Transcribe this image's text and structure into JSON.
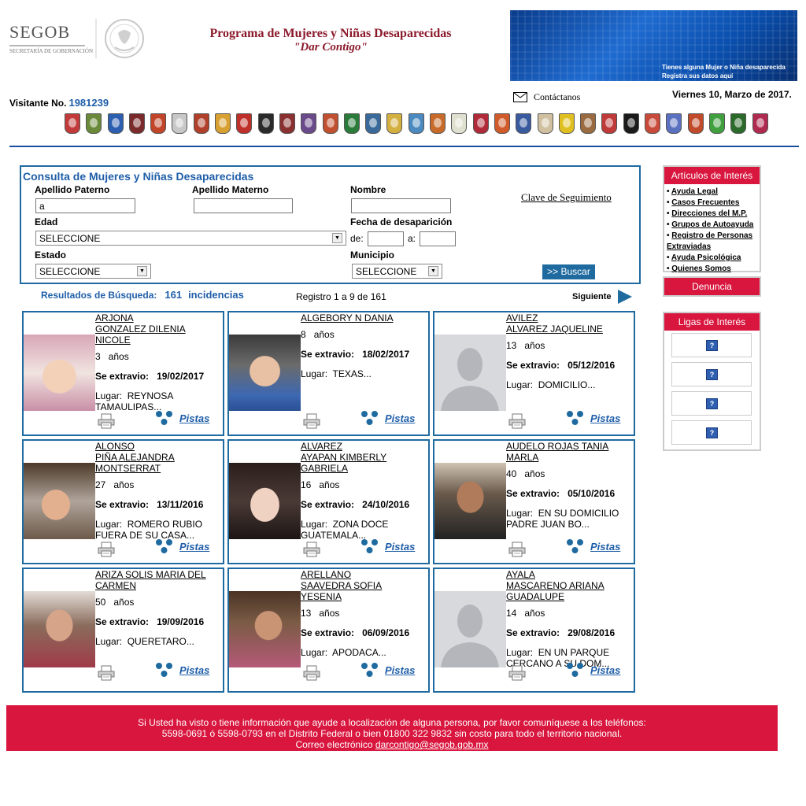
{
  "header": {
    "logo_text": "SEGOB",
    "logo_subtext": "SECRETARÍA DE GOBERNACIÓN",
    "program_title": "Programa de Mujeres y Niñas Desaparecidas",
    "program_subtitle": "\"Dar Contigo\"",
    "banner_line1": "Tienes alguna Mujer o Niña desaparecida",
    "banner_line2": "Registra sus datos aquí",
    "visitor_label": "Visitante No.",
    "visitor_number": "1981239",
    "contact_label": "Contáctanos",
    "date": "Viernes 10, Marzo de 2017."
  },
  "state_shields": [
    "#c23a3a",
    "#6a8a3a",
    "#2d5fb0",
    "#7a2a2a",
    "#c2452a",
    "#c8c8c8",
    "#b0402a",
    "#d8a030",
    "#c0302a",
    "#2a2a2a",
    "#8a3030",
    "#6a4a8a",
    "#c05030",
    "#2a7a3a",
    "#3a6a9a",
    "#d4b040",
    "#4a8ac0",
    "#c86a2a",
    "#e0e0d0",
    "#b02a3a",
    "#d05a2a",
    "#3a5aa0",
    "#d0c0a0",
    "#e0c020",
    "#9a6a40",
    "#c03a3a",
    "#1a1a1a",
    "#c84a3a",
    "#5a70c0",
    "#c04a2a",
    "#40a040",
    "#2a6a2a",
    "#b02a50"
  ],
  "search": {
    "title": "Consulta de Mujeres y Niñas Desaparecidas",
    "apellido_paterno_label": "Apellido Paterno",
    "apellido_paterno_value": "a",
    "apellido_materno_label": "Apellido Materno",
    "apellido_materno_value": "",
    "nombre_label": "Nombre",
    "nombre_value": "",
    "clave_link": "Clave de Seguimiento",
    "edad_label": "Edad",
    "edad_value": "SELECCIONE",
    "fecha_label": "Fecha de desaparición",
    "de_label": "de:",
    "a_label": "a:",
    "estado_label": "Estado",
    "estado_value": "SELECCIONE",
    "municipio_label": "Municipio",
    "municipio_value": "SELECCIONE",
    "buscar_label": ">> Buscar"
  },
  "results": {
    "label": "Resultados de Búsqueda:",
    "count": "161",
    "incidencias": "incidencias",
    "registro": "Registro 1 a 9 de 161",
    "siguiente": "Siguiente"
  },
  "card_labels": {
    "anos": "años",
    "se_extravio": "Se extravio:",
    "lugar": "Lugar:",
    "pistas": "Pistas"
  },
  "cards": [
    {
      "name": [
        "ARJONA",
        " GONZALEZ DILENIA",
        "NICOLE"
      ],
      "age": "3",
      "date": "19/02/2017",
      "lugar": [
        "REYNOSA",
        "TAMAULIPAS..."
      ],
      "photo": "child-girl"
    },
    {
      "name": [
        "ALGEBORY  N DANIA"
      ],
      "age": "8",
      "date": "18/02/2017",
      "lugar": [
        "TEXAS..."
      ],
      "photo": "child-girl"
    },
    {
      "name": [
        "AVILEZ",
        " ALVAREZ JAQUELINE"
      ],
      "age": "13",
      "date": "05/12/2016",
      "lugar": [
        "DOMICILIO..."
      ],
      "photo": "placeholder-silhouette"
    },
    {
      "name": [
        "ALONSO",
        " PIÑA ALEJANDRA",
        "MONTSERRAT"
      ],
      "age": "27",
      "date": "13/11/2016",
      "lugar": [
        "ROMERO RUBIO",
        "FUERA DE SU CASA..."
      ],
      "photo": "woman"
    },
    {
      "name": [
        "ALVAREZ",
        " AYAPAN KIMBERLY",
        "GABRIELA"
      ],
      "age": "16",
      "date": "24/10/2016",
      "lugar": [
        "ZONA DOCE",
        "GUATEMALA..."
      ],
      "photo": "teen-girl"
    },
    {
      "name": [
        "AUDELO  ROJAS TANIA",
        "MARLA"
      ],
      "age": "40",
      "date": "05/10/2016",
      "lugar": [
        "EN SU DOMICILIO",
        "PADRE JUAN BO..."
      ],
      "photo": "woman"
    },
    {
      "name": [
        "ARIZA  SOLIS MARIA DEL",
        "CARMEN"
      ],
      "age": "50",
      "date": "19/09/2016",
      "lugar": [
        "QUERETARO..."
      ],
      "photo": "woman"
    },
    {
      "name": [
        "ARELLANO",
        " SAAVEDRA SOFIA",
        "YESENIA"
      ],
      "age": "13",
      "date": "06/09/2016",
      "lugar": [
        "APODACA..."
      ],
      "photo": "teen-girl"
    },
    {
      "name": [
        "AYALA",
        " MASCARENO ARIANA",
        "GUADALUPE"
      ],
      "age": "14",
      "date": "29/08/2016",
      "lugar": [
        "EN UN PARQUE",
        "CERCANO A SU DOM..."
      ],
      "photo": "placeholder-silhouette"
    }
  ],
  "sidebar": {
    "articulos_title": "Artículos de Interés",
    "articulos": [
      "Ayuda Legal",
      "Casos Frecuentes",
      "Direcciones del M.P.",
      "Grupos de Autoayuda",
      "Registro de Personas Extraviadas",
      "Ayuda Psicológica",
      "Quienes Somos"
    ],
    "denuncia": "Denuncia",
    "ligas_title": "Ligas de Interés"
  },
  "footer": {
    "line1": "Si Usted ha visto o tiene información que ayude a localización de alguna persona, por favor comuníquese a los teléfonos:",
    "line2": "5598-0691 ó 5598-0793 en el Distrito Federal o bien 01800 322 9832 sin costo para todo el territorio nacional.",
    "line3_prefix": "Correo electrónico",
    "email": "darcontigo@segob.gob.mx"
  }
}
